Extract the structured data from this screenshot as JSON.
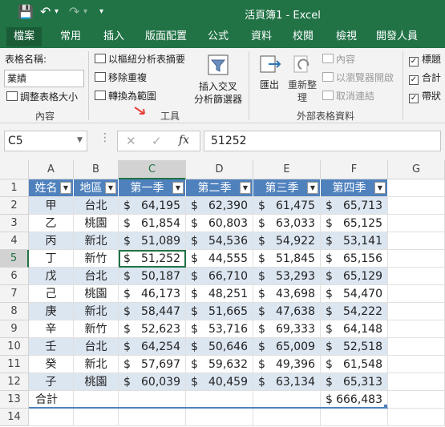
{
  "titlebar": {
    "title": "活頁簿1 - Excel",
    "save_icon": "💾",
    "undo_icon": "↶",
    "undo_arrow": "▾",
    "redo_icon": "↷",
    "redo_arrow": "▾",
    "customize_icon": "▾"
  },
  "tabs": [
    "檔案",
    "常用",
    "插入",
    "版面配置",
    "公式",
    "資料",
    "校閱",
    "檢視",
    "開發人員"
  ],
  "ribbon": {
    "properties": {
      "table_name_label": "表格名稱:",
      "table_name_value": "業績",
      "resize_table": "調整表格大小",
      "group_label": "內容"
    },
    "tools": {
      "summarize_pivot": "以樞紐分析表摘要",
      "remove_duplicates": "移除重複",
      "convert_to_range": "轉換為範圍",
      "insert_slicer_line1": "插入交叉",
      "insert_slicer_line2": "分析篩選器",
      "group_label": "工具"
    },
    "external": {
      "export": "匯出",
      "refresh_line1": "重新整",
      "refresh_line2": "理",
      "properties": "內容",
      "open_in_browser": "以瀏覽器開啟",
      "unlink": "取消連結",
      "group_label": "外部表格資料"
    },
    "style_options": {
      "header_row": "標題",
      "total_row": "合計",
      "banded_rows": "帶狀"
    }
  },
  "formula_bar": {
    "name_box": "C5",
    "fx_label": "fx",
    "value": "51252"
  },
  "columns": [
    "A",
    "B",
    "C",
    "D",
    "E",
    "F",
    "G"
  ],
  "rows": [
    "1",
    "2",
    "3",
    "4",
    "5",
    "6",
    "7",
    "8",
    "9",
    "10",
    "11",
    "12",
    "13",
    "14"
  ],
  "table": {
    "headers": [
      "姓名",
      "地區",
      "第一季",
      "第二季",
      "第三季",
      "第四季"
    ],
    "currency": "$",
    "data": [
      [
        "甲",
        "台北",
        "64,195",
        "62,390",
        "61,475",
        "65,713"
      ],
      [
        "乙",
        "桃園",
        "61,854",
        "60,803",
        "63,033",
        "65,125"
      ],
      [
        "丙",
        "新北",
        "51,089",
        "54,536",
        "54,922",
        "53,141"
      ],
      [
        "丁",
        "新竹",
        "51,252",
        "44,555",
        "51,845",
        "65,156"
      ],
      [
        "戊",
        "台北",
        "50,187",
        "66,710",
        "53,293",
        "65,129"
      ],
      [
        "己",
        "桃園",
        "46,173",
        "48,251",
        "43,698",
        "54,470"
      ],
      [
        "庚",
        "新北",
        "58,447",
        "51,665",
        "47,638",
        "54,222"
      ],
      [
        "辛",
        "新竹",
        "52,623",
        "53,716",
        "69,333",
        "64,148"
      ],
      [
        "壬",
        "台北",
        "64,254",
        "50,646",
        "65,009",
        "52,518"
      ],
      [
        "癸",
        "新北",
        "57,697",
        "59,632",
        "49,396",
        "61,548"
      ],
      [
        "子",
        "桃園",
        "60,039",
        "40,459",
        "63,134",
        "65,313"
      ]
    ],
    "total_label": "合計",
    "total_value": "666,483"
  }
}
